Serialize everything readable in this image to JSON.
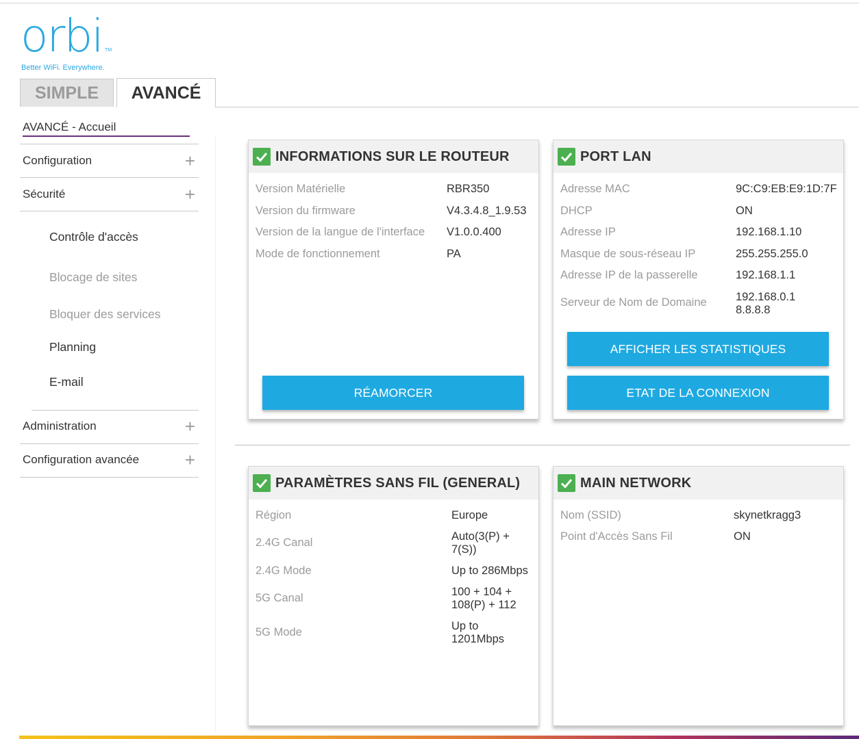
{
  "brand": {
    "logo": "orbi",
    "tm": "TM",
    "tagline": "Better WiFi. Everywhere."
  },
  "tabs": [
    {
      "label": "SIMPLE",
      "active": false
    },
    {
      "label": "AVANCÉ",
      "active": true
    }
  ],
  "sidebar": {
    "home": "AVANCÉ - Accueil",
    "sections": [
      {
        "label": "Configuration",
        "icon": "plus-icon"
      },
      {
        "label": "Sécurité",
        "icon": "plus-icon"
      },
      {
        "label": "Administration",
        "icon": "plus-icon"
      },
      {
        "label": "Configuration avancée",
        "icon": "plus-icon"
      }
    ],
    "security_items": [
      {
        "label": "Contrôle d'accès",
        "state": "enabled"
      },
      {
        "label": "Blocage de sites",
        "state": "disabled"
      },
      {
        "label": "Bloquer des services",
        "state": "disabled"
      },
      {
        "label": "Planning",
        "state": "enabled"
      },
      {
        "label": "E-mail",
        "state": "enabled"
      }
    ]
  },
  "router_info": {
    "title": "INFORMATIONS SUR LE ROUTEUR",
    "rows": [
      {
        "label": "Version Matérielle",
        "value": "RBR350"
      },
      {
        "label": "Version du firmware",
        "value": "V4.3.4.8_1.9.53"
      },
      {
        "label": "Version de la langue de l'interface",
        "value": "V1.0.0.400"
      },
      {
        "label": "Mode de fonctionnement",
        "value": "PA"
      }
    ],
    "button": "RÉAMORCER"
  },
  "lan_port": {
    "title": "PORT LAN",
    "rows": [
      {
        "label": "Adresse MAC",
        "value": "9C:C9:EB:E9:1D:7F"
      },
      {
        "label": "DHCP",
        "value": "ON"
      },
      {
        "label": "Adresse IP",
        "value": "192.168.1.10"
      },
      {
        "label": "Masque de sous-réseau IP",
        "value": "255.255.255.0"
      },
      {
        "label": "Adresse IP de la passerelle",
        "value": "192.168.1.1"
      },
      {
        "label": "Serveur de Nom de Domaine",
        "value": "192.168.0.1",
        "value2": "8.8.8.8"
      }
    ],
    "button_stats": "AFFICHER LES STATISTIQUES",
    "button_status": "ETAT DE LA CONNEXION"
  },
  "wireless": {
    "title": "PARAMÈTRES SANS FIL (GENERAL)",
    "rows": [
      {
        "label": "Région",
        "value": "Europe"
      },
      {
        "label": "2.4G Canal",
        "value": "Auto(3(P) +",
        "value2": "7(S))"
      },
      {
        "label": "2.4G Mode",
        "value": "Up to 286Mbps"
      },
      {
        "label": "5G Canal",
        "value": "100 + 104 +",
        "value2": "108(P) + 112"
      },
      {
        "label": "5G Mode",
        "value": "Up to",
        "value2": "1201Mbps"
      }
    ]
  },
  "main_network": {
    "title": "MAIN NETWORK",
    "rows": [
      {
        "label": "Nom (SSID)",
        "value": "skynetkragg3"
      },
      {
        "label": "Point d'Accès Sans Fil",
        "value": "ON"
      }
    ]
  },
  "colors": {
    "accent_blue": "#1fa9e1",
    "logo_blue": "#2ba8e0",
    "check_green": "#4caf50",
    "purple": "#6b2d7a"
  }
}
